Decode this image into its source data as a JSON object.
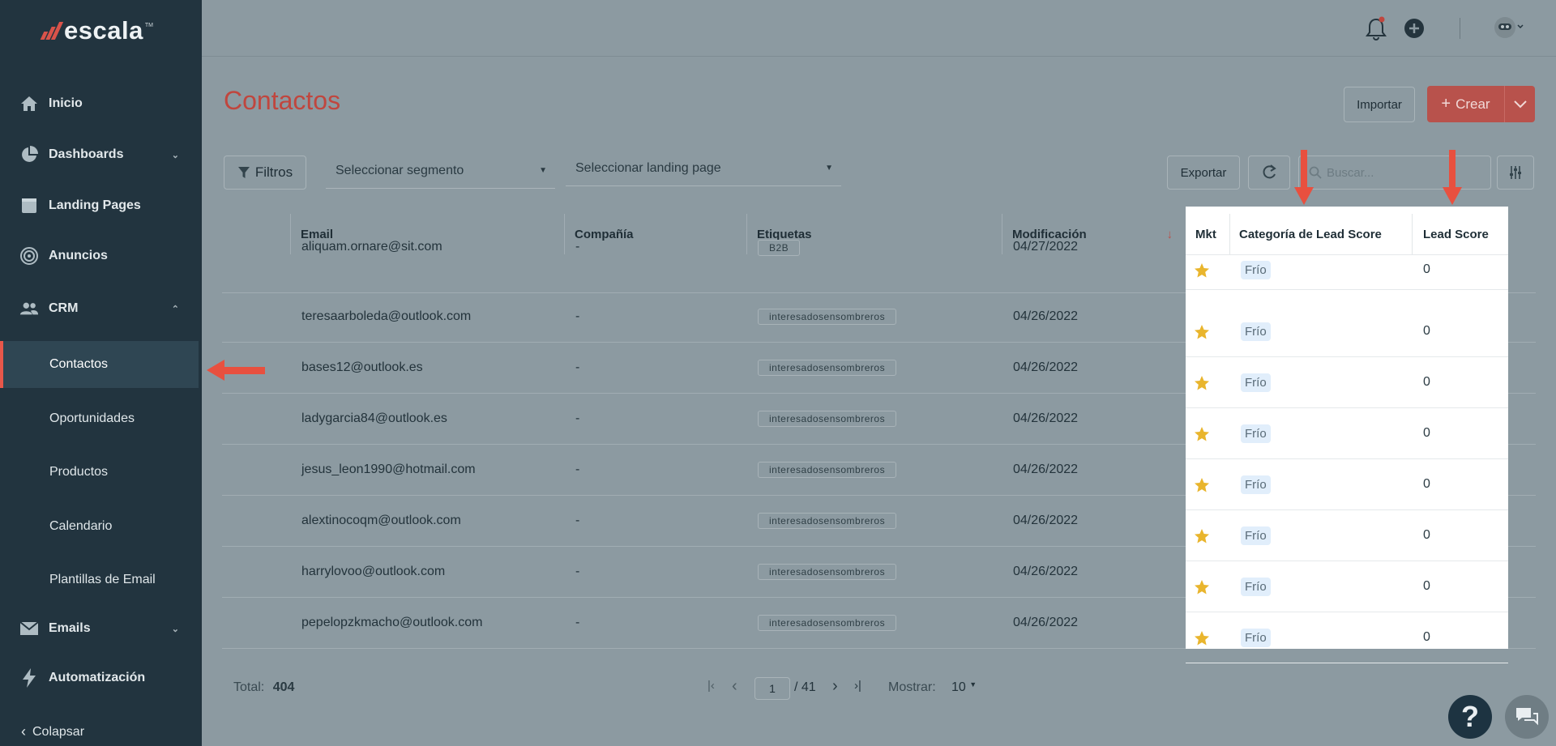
{
  "app": {
    "logo_text": "escala",
    "logo_tm": "TM"
  },
  "sidebar": {
    "items": [
      {
        "label": "Inicio",
        "icon": "home-icon"
      },
      {
        "label": "Dashboards",
        "icon": "pie-chart-icon"
      },
      {
        "label": "Landing Pages",
        "icon": "landing-page-icon"
      },
      {
        "label": "Anuncios",
        "icon": "target-icon"
      },
      {
        "label": "CRM",
        "icon": "users-icon"
      }
    ],
    "crm_subitems": [
      "Contactos",
      "Oportunidades",
      "Productos",
      "Calendario",
      "Plantillas de Email"
    ],
    "emails_label": "Emails",
    "automation_label": "Automatización",
    "collapse_label": "Colapsar",
    "active_subitem": "Contactos"
  },
  "header": {
    "title": "Contactos",
    "import_label": "Importar",
    "create_label": "Crear"
  },
  "filters": {
    "filters_label": "Filtros",
    "segment_placeholder": "Seleccionar segmento",
    "landing_placeholder": "Seleccionar landing page",
    "export_label": "Exportar",
    "search_placeholder": "Buscar..."
  },
  "table": {
    "columns": {
      "email": "Email",
      "company": "Compañía",
      "tags": "Etiquetas",
      "modified": "Modificación",
      "mkt": "Mkt",
      "lead_category": "Categoría de Lead Score",
      "lead_score": "Lead Score"
    },
    "rows": [
      {
        "email": "aliquam.ornare@sit.com",
        "company": "-",
        "tag": "B2B",
        "modified": "04/27/2022",
        "category": "Frío",
        "score": "0"
      },
      {
        "email": "teresaarboleda@outlook.com",
        "company": "-",
        "tag": "interesadosensombreros",
        "modified": "04/26/2022",
        "category": "Frío",
        "score": "0"
      },
      {
        "email": "bases12@outlook.es",
        "company": "-",
        "tag": "interesadosensombreros",
        "modified": "04/26/2022",
        "category": "Frío",
        "score": "0"
      },
      {
        "email": "ladygarcia84@outlook.es",
        "company": "-",
        "tag": "interesadosensombreros",
        "modified": "04/26/2022",
        "category": "Frío",
        "score": "0"
      },
      {
        "email": "jesus_leon1990@hotmail.com",
        "company": "-",
        "tag": "interesadosensombreros",
        "modified": "04/26/2022",
        "category": "Frío",
        "score": "0"
      },
      {
        "email": "alextinocoqm@outlook.com",
        "company": "-",
        "tag": "interesadosensombreros",
        "modified": "04/26/2022",
        "category": "Frío",
        "score": "0"
      },
      {
        "email": "harrylovoo@outlook.com",
        "company": "-",
        "tag": "interesadosensombreros",
        "modified": "04/26/2022",
        "category": "Frío",
        "score": "0"
      },
      {
        "email": "pepelopzkmacho@outlook.com",
        "company": "-",
        "tag": "interesadosensombreros",
        "modified": "04/26/2022",
        "category": "Frío",
        "score": "0"
      }
    ]
  },
  "footer": {
    "total_label": "Total:",
    "total_value": "404",
    "page_current": "1",
    "page_total": "/ 41",
    "show_label": "Mostrar:",
    "show_value": "10"
  },
  "colors": {
    "accent": "#c0463e",
    "annotation_arrow": "#e8503f",
    "sidebar": "#22343f"
  }
}
